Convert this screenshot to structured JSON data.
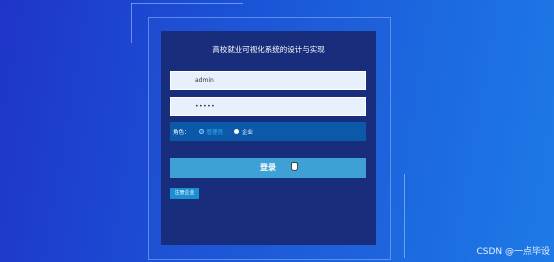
{
  "login_panel": {
    "title": "高校就业可视化系统的设计与实现",
    "username_value": "admin",
    "password_masked": "•••••",
    "role": {
      "label": "角色：",
      "options": [
        {
          "label": "管理员",
          "selected": true
        },
        {
          "label": "企业",
          "selected": false
        }
      ]
    },
    "login_label": "登录",
    "register_label": "注册企业"
  },
  "watermark": "CSDN @一点毕设",
  "colors": {
    "background_start": "#1f35c9",
    "background_end": "#1e7ae6",
    "panel": "#182e7c",
    "login_button": "#3fa0d6",
    "role_bar": "#0b59a8"
  }
}
